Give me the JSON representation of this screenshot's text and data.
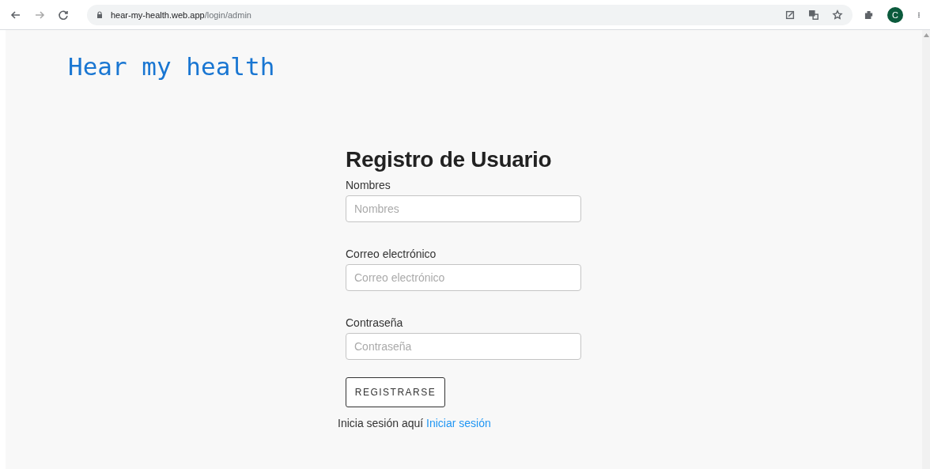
{
  "browser": {
    "url": {
      "host": "hear-my-health.web.app",
      "path": "/login/admin"
    },
    "avatar": "C"
  },
  "logo": "Hear my health",
  "form": {
    "title": "Registro de Usuario",
    "fields": [
      {
        "label": "Nombres",
        "placeholder": "Nombres"
      },
      {
        "label": "Correo electrónico",
        "placeholder": "Correo electrónico"
      },
      {
        "label": "Contraseña",
        "placeholder": "Contraseña"
      }
    ],
    "button": "REGISTRARSE",
    "footer": {
      "text": "Inicia sesión aquí",
      "link": "Iniciar sesión"
    }
  }
}
